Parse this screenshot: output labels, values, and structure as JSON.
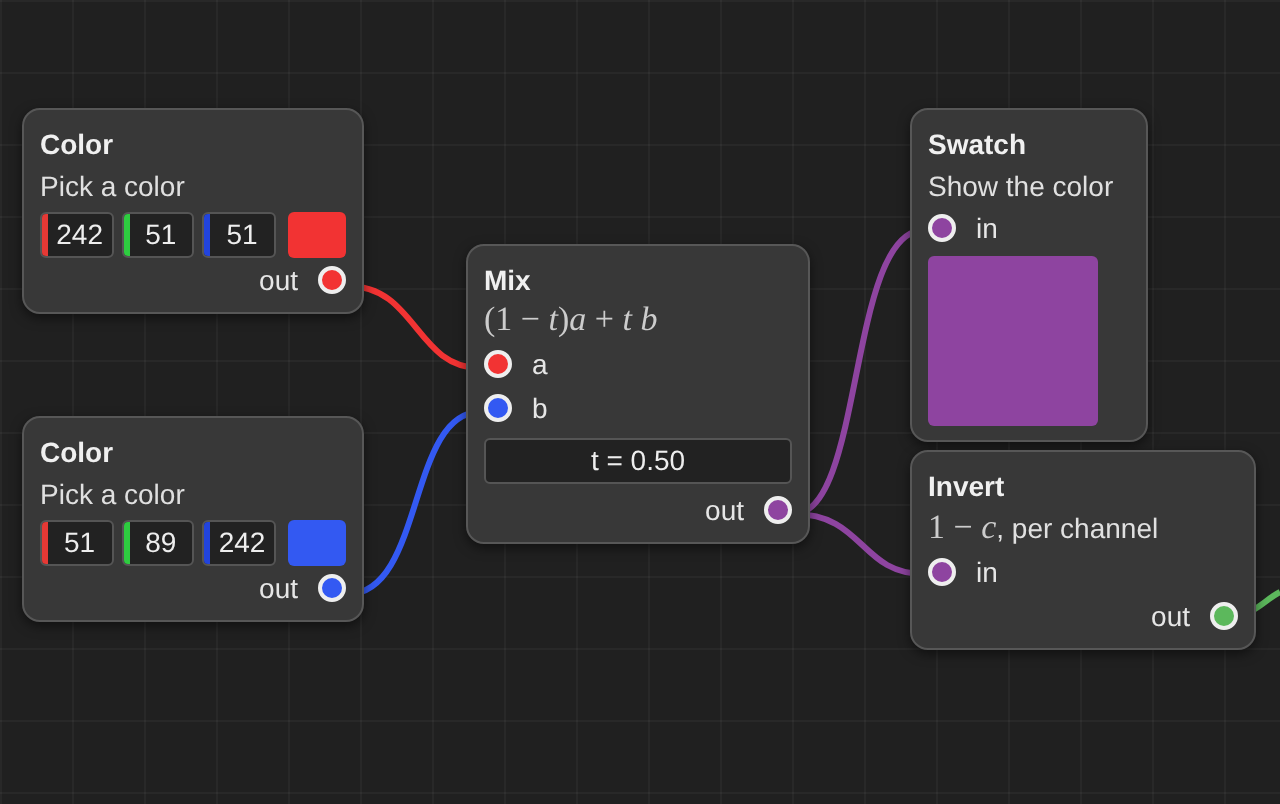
{
  "nodes": [
    {
      "kind": "color",
      "title": "Color",
      "subtitle": "Pick a color",
      "channels": [
        {
          "value": "242",
          "color": "#e53935"
        },
        {
          "value": "51",
          "color": "#2ecc40"
        },
        {
          "value": "51",
          "color": "#2244dd"
        }
      ],
      "color": "#f23333",
      "output": {
        "label": "out",
        "color": "#f23333"
      }
    },
    {
      "kind": "color",
      "title": "Color",
      "subtitle": "Pick a color",
      "channels": [
        {
          "value": "51",
          "color": "#e53935"
        },
        {
          "value": "89",
          "color": "#2ecc40"
        },
        {
          "value": "242",
          "color": "#2244dd"
        }
      ],
      "color": "#3359f2",
      "output": {
        "label": "out",
        "color": "#3359f2"
      }
    },
    {
      "kind": "mix",
      "title": "Mix",
      "formula": "(1 − *t*)*a* + *t b*",
      "inputs": [
        {
          "label": "a",
          "color": "#f23333"
        },
        {
          "label": "b",
          "color": "#3359f2"
        }
      ],
      "field": "t = 0.50",
      "output": {
        "label": "out",
        "color": "#8e44a0"
      }
    },
    {
      "kind": "swatch",
      "title": "Swatch",
      "subtitle": "Show the color",
      "inputs": [
        {
          "label": "in",
          "color": "#8e44a0"
        }
      ],
      "color": "#8e44a0"
    },
    {
      "kind": "invert",
      "title": "Invert",
      "formula": "1 − *c*",
      "subtitle": ", per channel",
      "inputs": [
        {
          "label": "in",
          "color": "#8e44a0"
        }
      ],
      "output": {
        "label": "out",
        "color": "#5cb85c"
      }
    }
  ]
}
